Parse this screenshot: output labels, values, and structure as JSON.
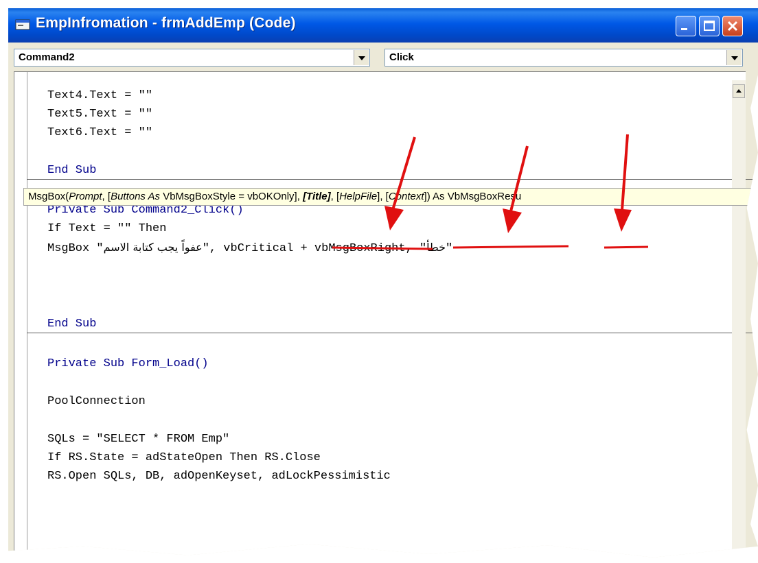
{
  "window": {
    "title": "EmpInfromation - frmAddEmp (Code)"
  },
  "toolbar": {
    "object_combo": "Command2",
    "procedure_combo": "Click"
  },
  "code": {
    "lines": [
      "Text4.Text = \"\"",
      "Text5.Text = \"\"",
      "Text6.Text = \"\"",
      "End Sub",
      "Private Sub Command2_Click()",
      "If Text = \"\" Then",
      "MsgBox \"",
      "عفواً يجب كتابة الاسم",
      "\", vbCritical + vbMsgBoxRight, \"",
      "خطأ",
      "\"",
      "End Sub",
      "Private Sub Form_Load()",
      "PoolConnection",
      "SQLs = \"SELECT * FROM Emp\"",
      "If RS.State = adStateOpen Then RS.Close",
      "RS.Open SQLs, DB, adOpenKeyset, adLockPessimistic"
    ]
  },
  "tooltip": {
    "parts": [
      "MsgBox(",
      "Prompt",
      ", [",
      "Buttons As",
      " VbMsgBoxStyle = vbOKOnly], ",
      "[Title]",
      ", [",
      "HelpFile",
      "], [",
      "Context",
      "]) As VbMsgBoxResu"
    ]
  },
  "icons": {
    "app": "app-form-icon",
    "minimize": "minimize-icon",
    "maximize": "maximize-icon",
    "close": "close-icon"
  },
  "colors": {
    "keyword": "#00008b",
    "titlebar": "#0058e6",
    "annotation": "#e01010",
    "tooltip_bg": "#ffffe1"
  }
}
